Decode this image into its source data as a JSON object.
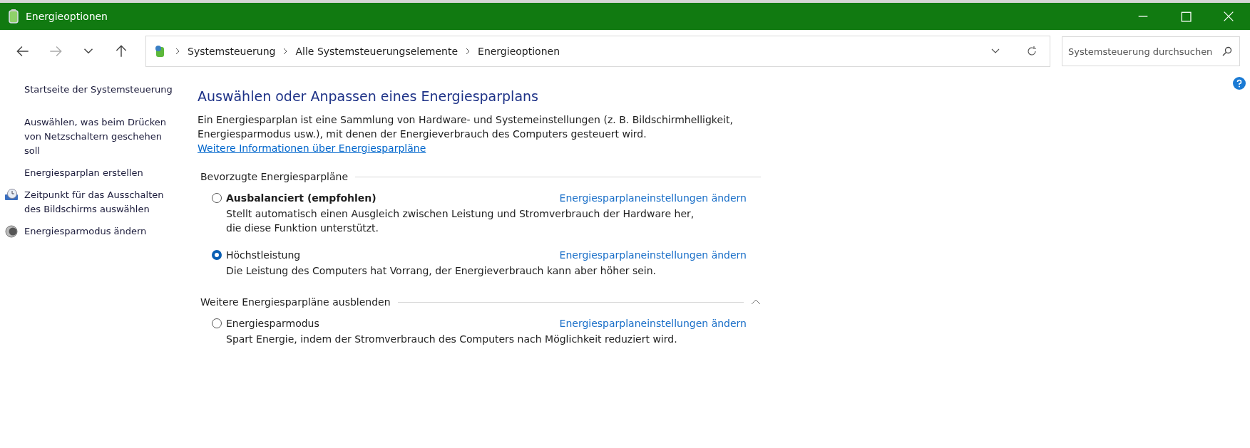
{
  "window": {
    "title": "Energieoptionen"
  },
  "address_bar": {
    "crumbs": [
      "Systemsteuerung",
      "Alle Systemsteuerungselemente",
      "Energieoptionen"
    ]
  },
  "search": {
    "placeholder": "Systemsteuerung durchsuchen"
  },
  "sidebar": {
    "items": [
      {
        "label": "Startseite der Systemsteuerung"
      },
      {
        "label": "Auswählen, was beim Drücken von Netzschaltern geschehen soll"
      },
      {
        "label": "Energiesparplan erstellen"
      },
      {
        "label": "Zeitpunkt für das Ausschalten des Bildschirms auswählen"
      },
      {
        "label": "Energiesparmodus ändern"
      }
    ]
  },
  "main": {
    "heading": "Auswählen oder Anpassen eines Energiesparplans",
    "intro": "Ein Energiesparplan ist eine Sammlung von Hardware- und Systemeinstellungen (z. B. Bildschirmhelligkeit, Energiesparmodus usw.), mit denen der Energieverbrauch des Computers gesteuert wird.",
    "intro_link": "Weitere Informationen über Energiesparpläne",
    "groups": [
      {
        "title": "Bevorzugte Energiesparpläne",
        "plans": [
          {
            "name": "Ausbalanciert (empfohlen)",
            "emphasized": true,
            "selected": false,
            "description": "Stellt automatisch einen Ausgleich zwischen Leistung und Stromverbrauch der Hardware her, die diese Funktion unterstützt.",
            "link": "Energiesparplaneinstellungen ändern"
          },
          {
            "name": "Höchstleistung",
            "emphasized": false,
            "selected": true,
            "description": "Die Leistung des Computers hat Vorrang, der Energieverbrauch kann aber höher sein.",
            "link": "Energiesparplaneinstellungen ändern"
          }
        ]
      },
      {
        "title": "Weitere Energiesparpläne ausblenden",
        "expanded": true,
        "plans": [
          {
            "name": "Energiesparmodus",
            "emphasized": false,
            "selected": false,
            "description": "Spart Energie, indem der Stromverbrauch des Computers nach Möglichkeit reduziert wird.",
            "link": "Energiesparplaneinstellungen ändern"
          }
        ]
      }
    ]
  }
}
